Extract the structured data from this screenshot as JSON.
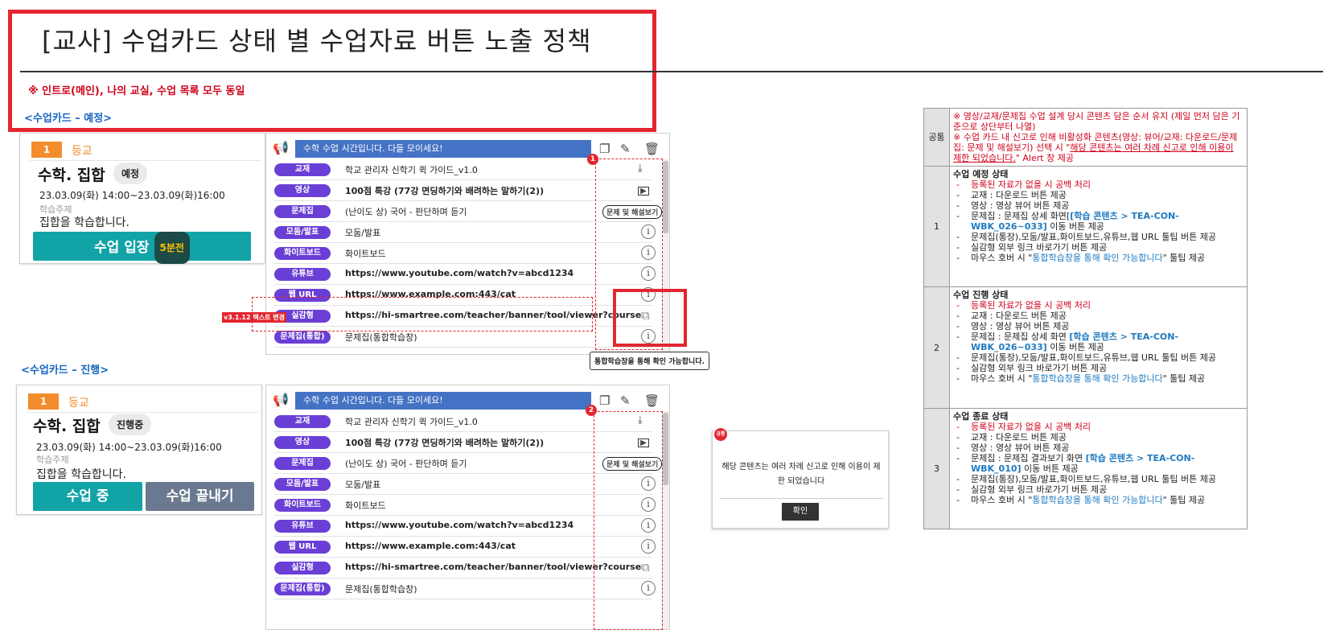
{
  "title": "[교사] 수업카드 상태 별 수업자료 버튼 노출 정책",
  "notice": "※ 인트로(메인), 나의 교실, 수업 목록 모두 동일",
  "sections": {
    "scheduled": "<수업카드 – 예정>",
    "ongoing": "<수업카드 – 진행>"
  },
  "card1": {
    "num": "1",
    "grade": "등교",
    "class": "수학. 집합",
    "status": "예정",
    "date": "23.03.09(화) 14:00~23.03.09(화)16:00",
    "topic_label": "학습주제",
    "topic": "집합을 학습합니다.",
    "enter": "수업 입장",
    "mins": "5분전"
  },
  "card2": {
    "num": "1",
    "grade": "등교",
    "class": "수학. 집합",
    "status": "진행중",
    "date": "23.03.09(화) 14:00~23.03.09(화)16:00",
    "topic_label": "학습주제",
    "topic": "집합을 학습합니다.",
    "in_class": "수업 중",
    "end_class": "수업 끝내기"
  },
  "panel1": {
    "banner": "수학 수업 시간입니다. 다들 모이세요!",
    "badge": "1",
    "rows": [
      {
        "tag": "교재",
        "text": "학교 관리자 신학기 퀵 가이드_v1.0",
        "action": "download-icon"
      },
      {
        "tag": "영상",
        "text": "100점 특강 (77강 면딩하기와 배려하는 말하기(2))",
        "action": "play-icon"
      },
      {
        "tag": "문제집",
        "text": "(난이도 상) 국어 - 판단하며 듣기",
        "action": "solution"
      },
      {
        "tag": "모둠/발표",
        "text": "모둠/발표",
        "action": "info-icon"
      },
      {
        "tag": "화이트보드",
        "text": "화이트보드",
        "action": "info-icon"
      },
      {
        "tag": "유튜브",
        "text": "https://www.youtube.com/watch?v=abcd1234",
        "action": "info-icon"
      },
      {
        "tag": "웹 URL",
        "text": "https://www.example.com:443/cat",
        "action": "info-icon"
      },
      {
        "tag": "실감형",
        "text": "https://hi-smartree.com/teacher/banner/tool/viewer?course",
        "action": "external-link-icon"
      },
      {
        "tag": "문제집(통합)",
        "text": "문제집(통합학습창)",
        "action": "info-icon"
      }
    ],
    "solution_label": "문제 및 해설보기",
    "version_note": "v3.1.12 텍스트 변경",
    "tooltip": "통합학습창을 통해 확인 가능합니다."
  },
  "panel2": {
    "banner": "수학 수업 시간입니다. 다들 모이세요!",
    "badge": "2",
    "rows": [
      {
        "tag": "교재",
        "text": "학교 관리자 신학기 퀵 가이드_v1.0",
        "action": "download-icon"
      },
      {
        "tag": "영상",
        "text": "100점 특강 (77강 면딩하기와 배려하는 말하기(2))",
        "action": "play-icon"
      },
      {
        "tag": "문제집",
        "text": "(난이도 상) 국어 - 판단하며 듣기",
        "action": "solution"
      },
      {
        "tag": "모둠/발표",
        "text": "모둠/발표",
        "action": "info-icon"
      },
      {
        "tag": "화이트보드",
        "text": "화이트보드",
        "action": "info-icon"
      },
      {
        "tag": "유튜브",
        "text": "https://www.youtube.com/watch?v=abcd1234",
        "action": "info-icon"
      },
      {
        "tag": "웹 URL",
        "text": "https://www.example.com:443/cat",
        "action": "info-icon"
      },
      {
        "tag": "실감형",
        "text": "https://hi-smartree.com/teacher/banner/tool/viewer?course",
        "action": "external-link-icon"
      },
      {
        "tag": "문제집(통합)",
        "text": "문제집(통합학습창)",
        "action": "info-icon"
      }
    ],
    "solution_label": "문제 및 해설보기"
  },
  "popup": {
    "badge": "공통",
    "message": "해당 콘텐츠는 여러 차례 신고로 인해 이용이 제한 되었습니다",
    "ok": "확인"
  },
  "policy": {
    "common_head": "공통",
    "common_1": "※ 영상/교재/문제집 수업 설계 당시 콘텐츠 담은 순서 유지 (제일 먼저 담은 기준으로 상단부터 나열)",
    "common_2a": "※ 수업 카드 내 신고로 인해 비활성화 콘텐츠(영상: 뷰어/교재: 다운로드/문제집: 문제 및 해설보기) 선택 시 \"",
    "common_2b": "해당 콘텐츠는 여러 차례 신고로 인해 이용이 제한 되었습니다.",
    "common_2c": "\" Alert 창 제공",
    "rows": [
      {
        "num": "1",
        "title": "수업 예정 상태",
        "empty": "등록된 자료가 없을 시 공백 처리",
        "textbook": "교재 : 다운로드 버튼 제공",
        "video": "영상 : 영상 뷰어 버튼 제공",
        "qb_pre": "문제집 : 문제집 상세 화면[",
        "qb_link": "[학습 콘텐츠 > TEA-CON-WBK_026~033]",
        "qb_post": " 이동 버튼 제공",
        "tooltip_items": "문제집(통장),모둠/발표,화이트보드,유튜브,웹 URL 툴팁 버튼 제공",
        "external": "실감형 외부 링크 바로가기 버튼 제공",
        "hover_pre": "마우스 호버 시 \"",
        "hover_link": "통합학습창을 통해 확인 가능합니다",
        "hover_post": "\" 툴팁 제공"
      },
      {
        "num": "2",
        "title": "수업 진행 상태",
        "empty": "등록된 자료가 없을 시 공백 처리",
        "textbook": "교재 : 다운로드 버튼 제공",
        "video": "영상 : 영상 뷰어 버튼 제공",
        "qb_pre": "문제집 : 문제집 상세 화면 ",
        "qb_link": "[학습 콘텐츠 > TEA-CON-WBK_026~033]",
        "qb_post": " 이동 버튼 제공",
        "tooltip_items": "문제집(통장),모둠/발표,화이트보드,유튜브,웹 URL 툴팁 버튼 제공",
        "external": "실감형 외부 링크 바로가기 버튼 제공",
        "hover_pre": "마우스 호버 시 \"",
        "hover_link": "통합학습창을 통해 확인 가능합니다",
        "hover_post": "\" 툴팁 제공"
      },
      {
        "num": "3",
        "title": "수업 종료 상태",
        "empty": "등록된 자료가 없을 시 공백 처리",
        "textbook": "교재 : 다운로드 버튼 제공",
        "video": "영상 : 영상 뷰어 버튼 제공",
        "qb_pre": "문제집 : 문제집 결과보기 화면 ",
        "qb_link": "[학습 콘텐츠 > TEA-CON-WBK_010]",
        "qb_post": " 이동 버튼 제공",
        "tooltip_items": "문제집(통장),모둠/발표,화이트보드,유튜브,웹 URL 툴팁 버튼 제공",
        "external": "실감형 외부 링크 바로가기 버튼 제공",
        "hover_pre": "마우스 호버 시 \"",
        "hover_link": "통합학습창을 통해 확인 가능합니다",
        "hover_post": "\" 툴팁 제공"
      }
    ]
  },
  "colors": {
    "accent_red": "#e3262f",
    "teal": "#12a3a7",
    "purple_tag": "#6a3fd5",
    "banner_blue": "#4472c4",
    "orange": "#f28c2c"
  }
}
